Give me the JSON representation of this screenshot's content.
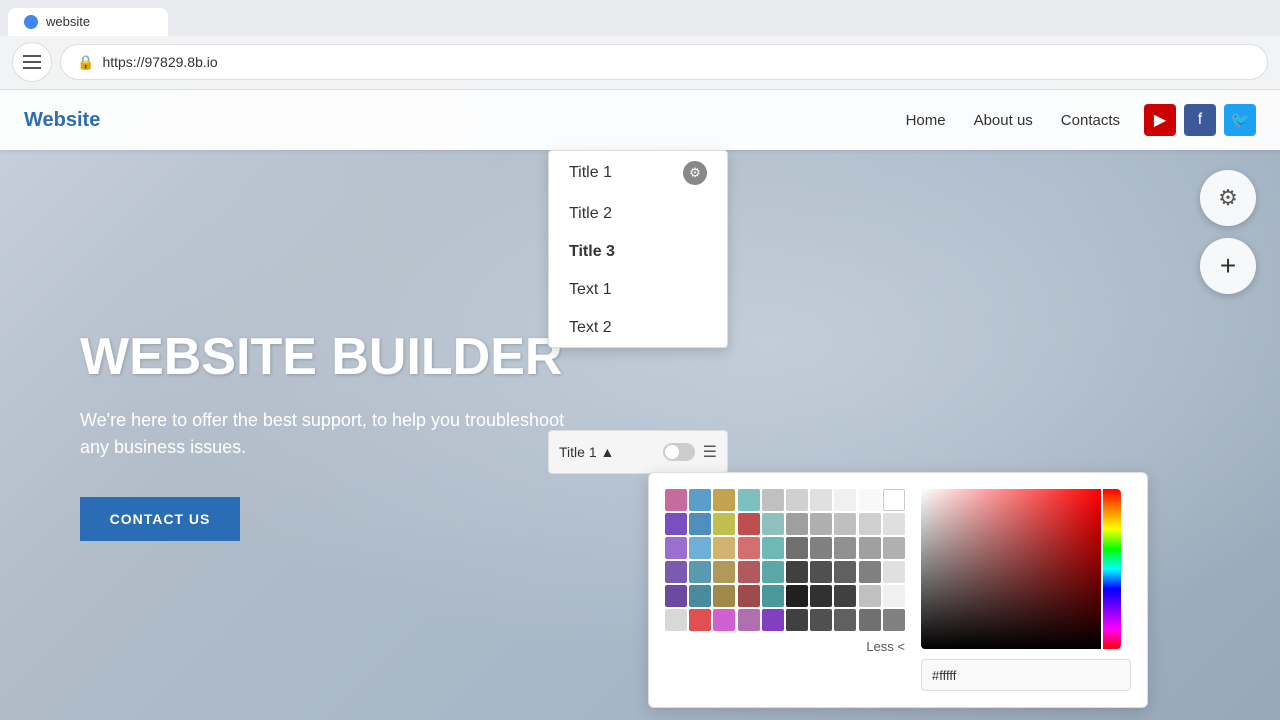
{
  "browser": {
    "tab_label": "website",
    "url": "https://97829.8b.io",
    "lock_icon": "🔒"
  },
  "nav": {
    "logo": "Website",
    "links": [
      "Home",
      "About us",
      "Contacts"
    ],
    "social": {
      "youtube_label": "YouTube",
      "facebook_label": "Facebook",
      "twitter_label": "Twitter"
    }
  },
  "hero": {
    "title": "WEBSITE BUILDER",
    "subtitle": "We're here to offer the best support, to help you troubleshoot any business issues.",
    "cta_label": "CONTACT US"
  },
  "dropdown": {
    "items": [
      {
        "label": "Title 1",
        "weight": "normal",
        "has_gear": true
      },
      {
        "label": "Title 2",
        "weight": "normal",
        "has_gear": false
      },
      {
        "label": "Title 3",
        "weight": "bold",
        "has_gear": false
      },
      {
        "label": "Text 1",
        "weight": "normal",
        "has_gear": false
      },
      {
        "label": "Text 2",
        "weight": "normal",
        "has_gear": false
      }
    ],
    "toolbar": {
      "label": "Title 1",
      "chevron": "▲"
    }
  },
  "color_picker": {
    "swatches": [
      "#c56b9e",
      "#5b9ec9",
      "#c4a34f",
      "#7bbfbf",
      "#c0c0c0",
      "#d0d0d0",
      "#e0e0e0",
      "#f0f0f0",
      "#f5f5f5",
      "#ffffff",
      "#7b4fbf",
      "#4f8fbf",
      "#bfbf4f",
      "#bf4f4f",
      "#8fbfbf",
      "#9f9f9f",
      "#afafaf",
      "#bfbfbf",
      "#cfcfcf",
      "#dfdfdf",
      "#9b6fd0",
      "#6fb0d8",
      "#d4b36f",
      "#d46f6f",
      "#6fb8b8",
      "#707070",
      "#808080",
      "#909090",
      "#a0a0a0",
      "#b0b0b0",
      "#7b5ab0",
      "#5a9ab0",
      "#b09a5a",
      "#b05a5a",
      "#5aa8a8",
      "#404040",
      "#505050",
      "#606060",
      "#808080",
      "#e0e0e0",
      "#6b4a9f",
      "#4a8a9f",
      "#9f8a4a",
      "#9f4a4a",
      "#4a9898",
      "#202020",
      "#303030",
      "#404040",
      "#c0c0c0",
      "#f0f0f0",
      "#e0e0e0",
      "#e05050",
      "#d060d0",
      "#b070b0",
      "#8040c0",
      "#404040",
      "#505050",
      "#606060",
      "#707070",
      "#808080"
    ],
    "less_label": "Less <",
    "hex_value": "#fffff",
    "gradient_colors": {
      "from": "#ff0000",
      "to_black": "#000000",
      "white_start": "#ffffff"
    }
  },
  "fabs": {
    "settings_icon": "⚙",
    "add_icon": "+"
  }
}
